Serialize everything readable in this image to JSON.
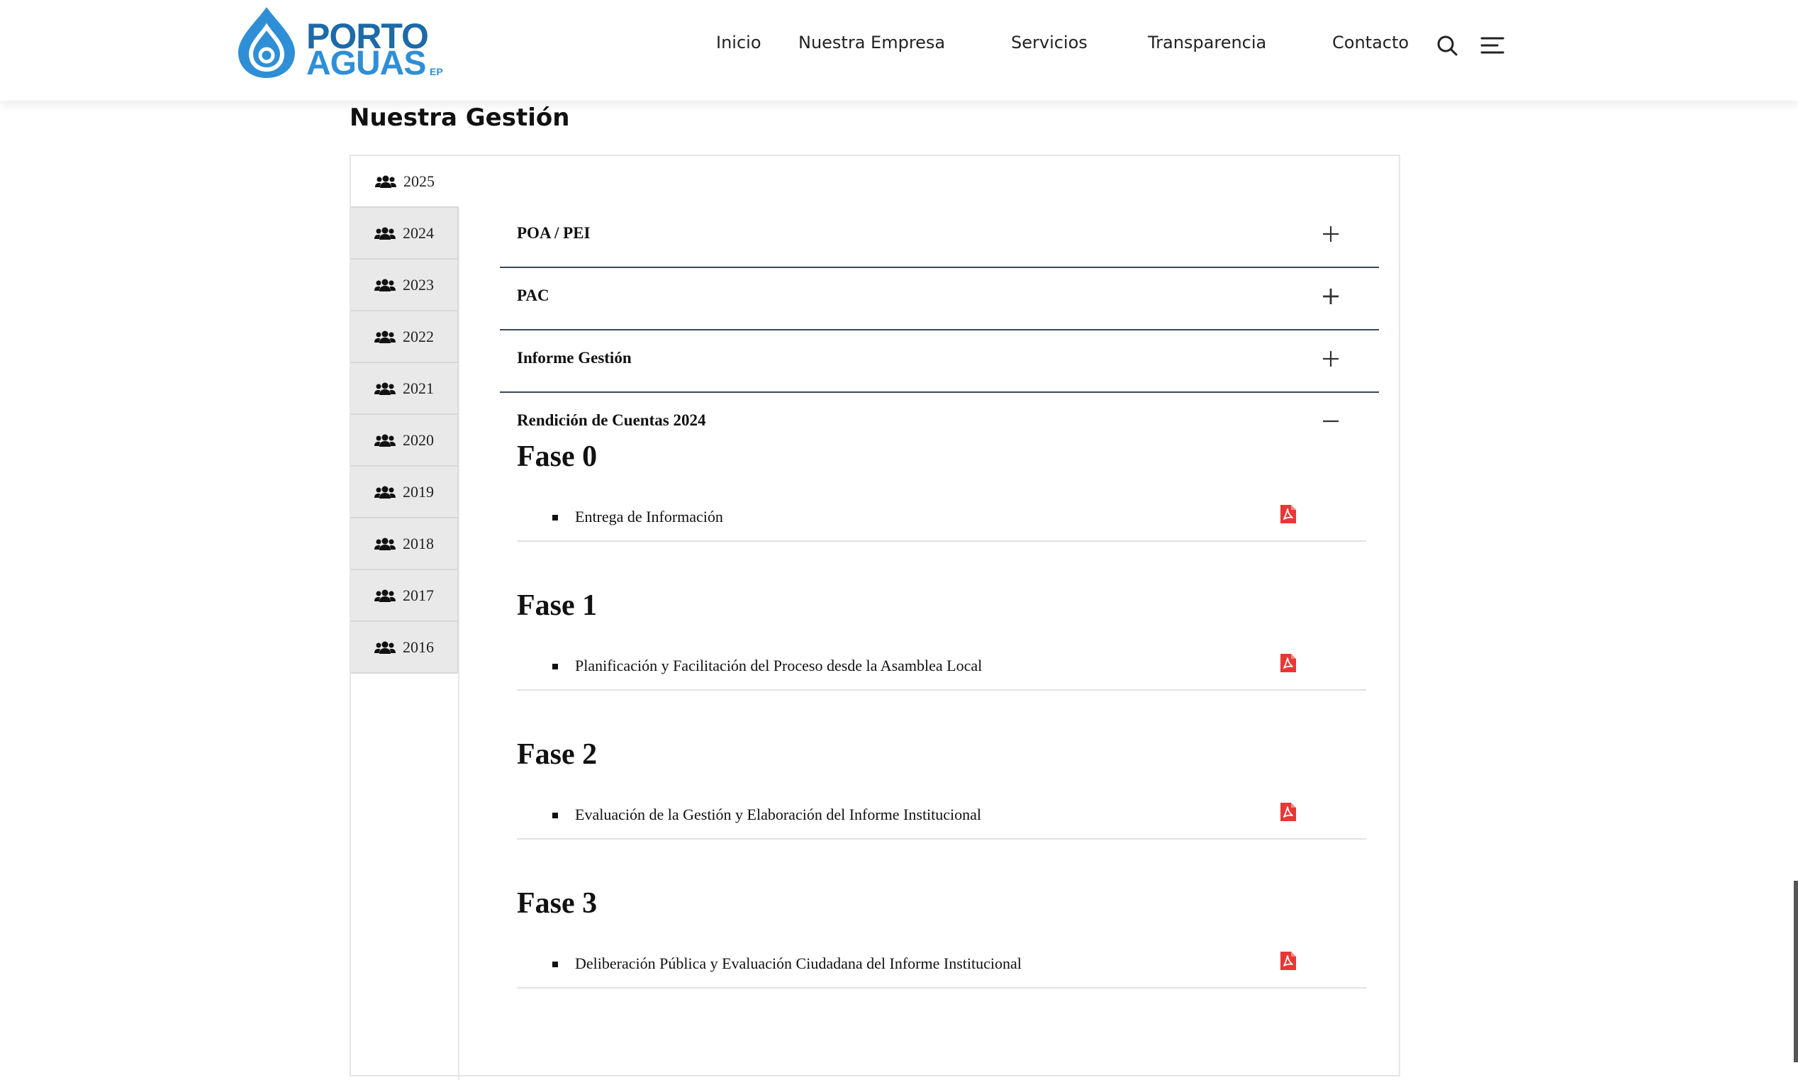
{
  "header": {
    "logo": {
      "line1": "PORTO",
      "line2": "AGUAS",
      "suffix": "EP"
    },
    "nav": [
      {
        "label": "Inicio"
      },
      {
        "label": "Nuestra Empresa"
      },
      {
        "label": "Servicios"
      },
      {
        "label": "Transparencia"
      },
      {
        "label": "Contacto"
      }
    ],
    "icons": {
      "search": "search-icon",
      "menu": "hamburger-menu-icon"
    }
  },
  "section": {
    "title": "Nuestra Gestión"
  },
  "tabs": {
    "icon": "users-icon",
    "active": "2025",
    "items": [
      "2025",
      "2024",
      "2023",
      "2022",
      "2021",
      "2020",
      "2019",
      "2018",
      "2017",
      "2016"
    ]
  },
  "accordion": [
    {
      "title": "POA / PEI",
      "state": "collapsed"
    },
    {
      "title": "PAC",
      "state": "collapsed"
    },
    {
      "title": "Informe Gestión",
      "state": "collapsed"
    },
    {
      "title": "Rendición de Cuentas 2024",
      "state": "expanded"
    }
  ],
  "phases": [
    {
      "title": "Fase 0",
      "doc": "Entrega de Información"
    },
    {
      "title": "Fase 1",
      "doc": "Planificación y Facilitación del Proceso desde la Asamblea Local"
    },
    {
      "title": "Fase 2",
      "doc": "Evaluación de la Gestión y Elaboración del Informe Institucional"
    },
    {
      "title": "Fase 3",
      "doc": "Deliberación Pública y Evaluación Ciudadana del Informe Institucional"
    }
  ],
  "colors": {
    "brand_dark": "#1c6aa8",
    "brand_light": "#2f8fd6",
    "pdf_red": "#e53935",
    "divider": "#3a4a5a"
  }
}
